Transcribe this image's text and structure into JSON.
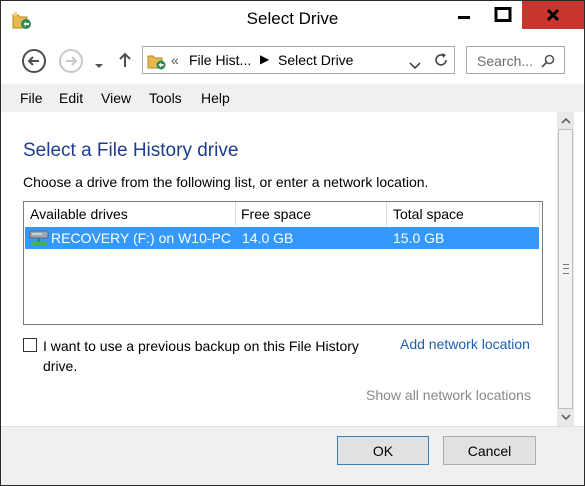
{
  "window": {
    "title": "Select Drive"
  },
  "address": {
    "crumbs": [
      "File Hist...",
      "Select Drive"
    ]
  },
  "search": {
    "placeholder": "Search..."
  },
  "menu": [
    "File",
    "Edit",
    "View",
    "Tools",
    "Help"
  ],
  "main": {
    "heading": "Select a File History drive",
    "description": "Choose a drive from the following list, or enter a network location.",
    "table": {
      "columns": [
        "Available drives",
        "Free space",
        "Total space"
      ],
      "rows": [
        {
          "name": "RECOVERY (F:) on W10-PC",
          "free": "14.0 GB",
          "total": "15.0 GB",
          "selected": true
        }
      ]
    },
    "checkbox_label": "I want to use a previous backup on this File History drive.",
    "add_network_link": "Add network location",
    "show_all_link": "Show all network locations"
  },
  "buttons": {
    "ok": "OK",
    "cancel": "Cancel"
  },
  "colors": {
    "accent": "#3399ff",
    "heading": "#1e3d8f",
    "link": "#1a5fb4",
    "close": "#c7352d"
  }
}
